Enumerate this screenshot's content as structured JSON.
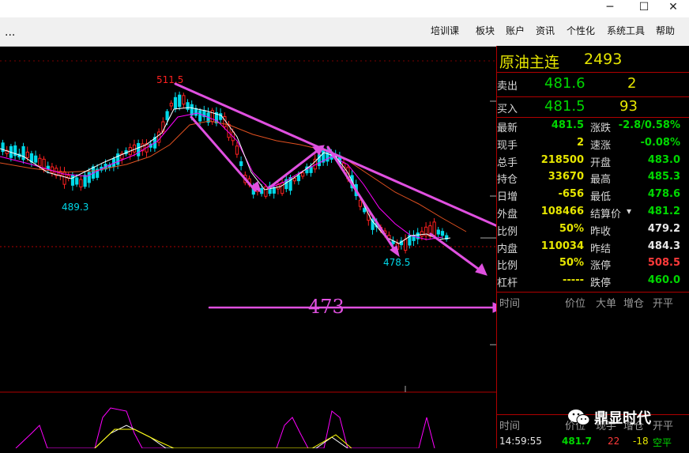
{
  "window": {
    "minimize": "─",
    "maximize": "☐",
    "close": "✕"
  },
  "menu": {
    "overflow": "...",
    "items": [
      "培训课",
      "板块",
      "账户",
      "资讯",
      "个性化",
      "系统工具",
      "帮助"
    ]
  },
  "chart": {
    "price_annotations": {
      "high": "511.5",
      "low_left": "489.3",
      "low_right": "478.5"
    },
    "target_label": "473",
    "colors": {
      "up": "#ff2020",
      "down": "#00d8e8",
      "ma_fast": "#ffffff",
      "ma_mid": "#ffff00",
      "ma_slow": "#ff00ff",
      "trend_arrow": "#e050e0"
    }
  },
  "quote": {
    "title": "原油主连",
    "code": "2493",
    "sell_label": "卖出",
    "sell_price": "481.6",
    "sell_vol": "2",
    "buy_label": "买入",
    "buy_price": "481.5",
    "buy_vol": "93",
    "left_rows": [
      {
        "label": "最新",
        "value": "481.5",
        "color": "grn"
      },
      {
        "label": "现手",
        "value": "2",
        "color": "yel"
      },
      {
        "label": "总手",
        "value": "218500",
        "color": "yel"
      },
      {
        "label": "持仓",
        "value": "33670",
        "color": "yel"
      },
      {
        "label": "日增",
        "value": "-656",
        "color": "yel"
      },
      {
        "label": "外盘",
        "value": "108466",
        "color": "yel"
      },
      {
        "label": "比例",
        "value": "50%",
        "color": "yel"
      },
      {
        "label": "内盘",
        "value": "110034",
        "color": "yel"
      },
      {
        "label": "比例",
        "value": "50%",
        "color": "yel"
      },
      {
        "label": "杠杆",
        "value": "-----",
        "color": "yel"
      }
    ],
    "right_rows": [
      {
        "label": "涨跌",
        "value": "-2.8/0.58%",
        "color": "grn"
      },
      {
        "label": "速涨",
        "value": "-0.08%",
        "color": "grn"
      },
      {
        "label": "开盘",
        "value": "483.0",
        "color": "grn"
      },
      {
        "label": "最高",
        "value": "485.3",
        "color": "grn"
      },
      {
        "label": "最低",
        "value": "478.6",
        "color": "grn"
      },
      {
        "label": "结算价",
        "value": "481.2",
        "color": "grn"
      },
      {
        "label": "昨收",
        "value": "479.2",
        "color": "wht"
      },
      {
        "label": "昨结",
        "value": "484.3",
        "color": "wht"
      },
      {
        "label": "涨停",
        "value": "508.5",
        "color": "red"
      },
      {
        "label": "跌停",
        "value": "460.0",
        "color": "grn"
      }
    ],
    "ticks_header": [
      "时间",
      "价位",
      "大单",
      "增仓",
      "开平"
    ],
    "ticks_header2": [
      "时间",
      "价位",
      "现手",
      "增仓",
      "开平"
    ],
    "tick_row": {
      "time": "14:59:55",
      "price": "481.7",
      "vol": "22",
      "oi": "-18",
      "type": "空平"
    }
  },
  "watermark": "鼎显时代"
}
